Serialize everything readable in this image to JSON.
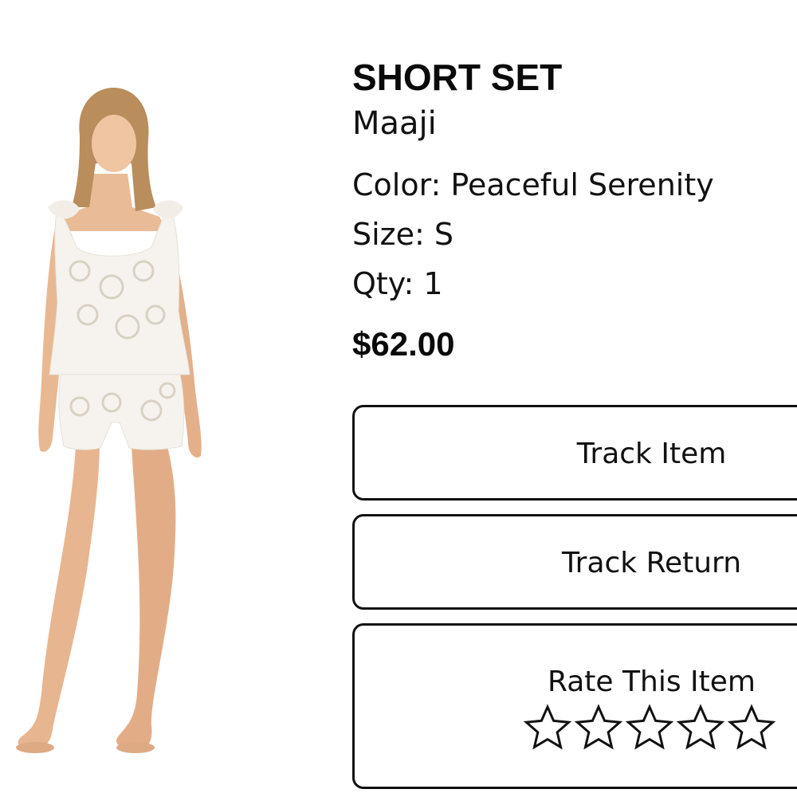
{
  "product": {
    "title": "SHORT SET",
    "brand": "Maaji",
    "color_line": "Color: Peaceful Serenity",
    "size_line": "Size: S",
    "qty_line": "Qty: 1",
    "price": "$62.00"
  },
  "actions": {
    "track_item": "Track Item",
    "track_return": "Track Return",
    "rate_item": "Rate This Item"
  },
  "rating": {
    "max_stars": 5,
    "selected": 0
  },
  "colors": {
    "text": "#111111",
    "border": "#111111",
    "background": "#ffffff"
  },
  "icons": {
    "rating_star": "star-outline-icon"
  }
}
